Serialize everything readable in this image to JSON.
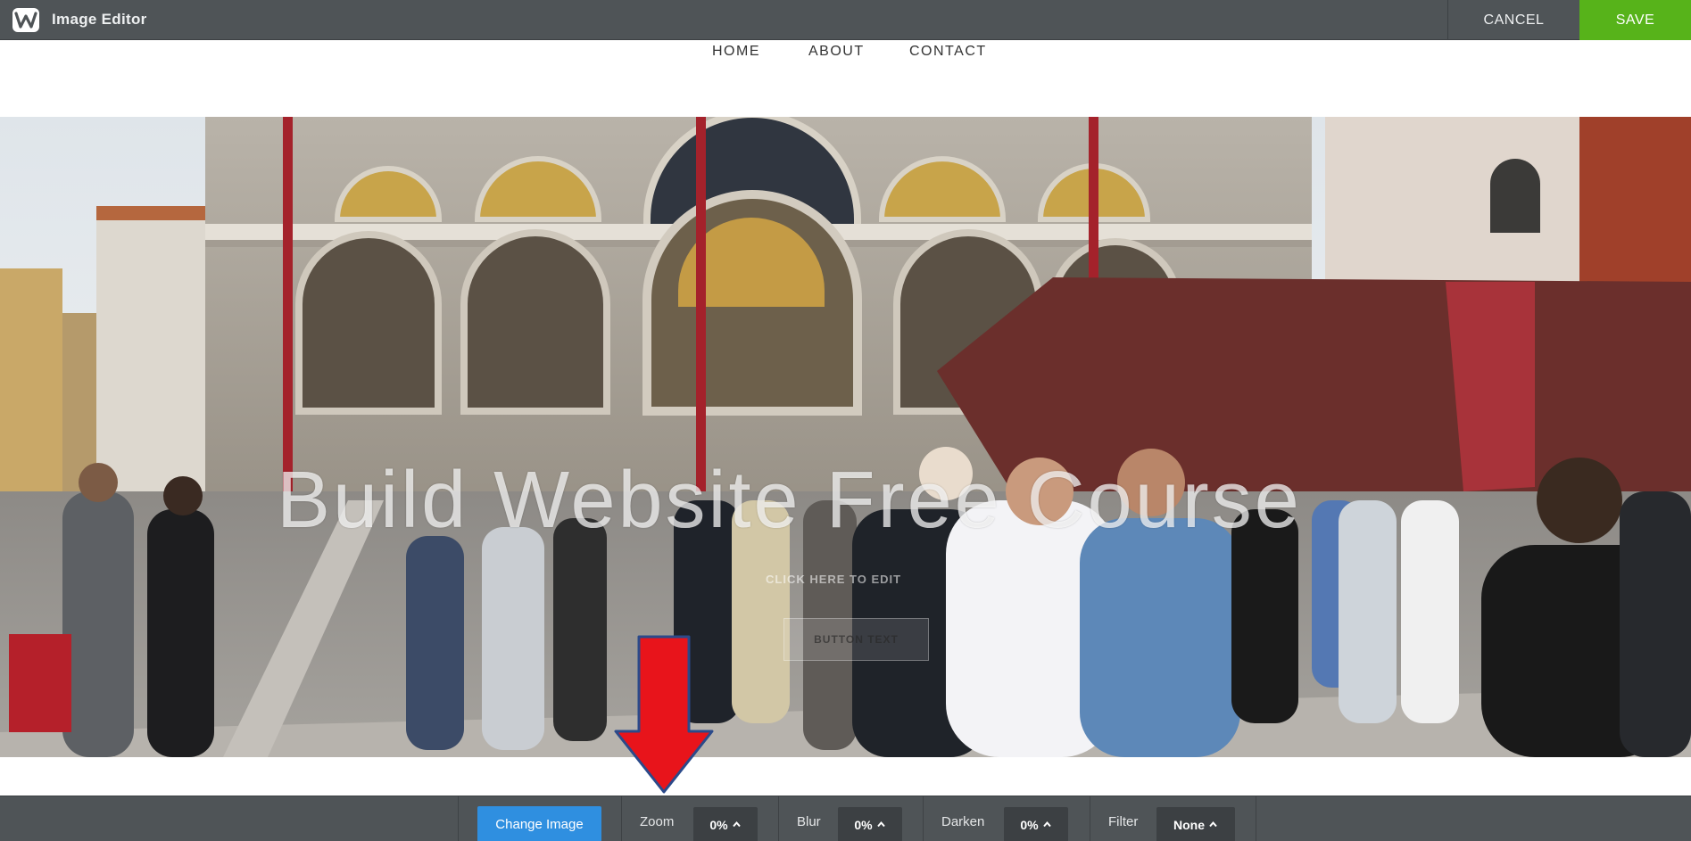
{
  "app": {
    "title": "Image Editor",
    "logo": "weebly-w-logo"
  },
  "topbar": {
    "cancel_label": "CANCEL",
    "save_label": "SAVE"
  },
  "site_nav": {
    "items": [
      "HOME",
      "ABOUT",
      "CONTACT"
    ]
  },
  "hero": {
    "heading": "Build Website Free Course",
    "cta_hint": "CLICK HERE TO EDIT",
    "button_text": "BUTTON TEXT"
  },
  "annotation": {
    "icon": "red-down-arrow-icon",
    "color": "#e8141b"
  },
  "toolbar": {
    "change_image_label": "Change Image",
    "zoom": {
      "label": "Zoom",
      "value": "0%"
    },
    "blur": {
      "label": "Blur",
      "value": "0%"
    },
    "darken": {
      "label": "Darken",
      "value": "0%"
    },
    "filter": {
      "label": "Filter",
      "value": "None"
    }
  },
  "colors": {
    "bar": "#4f5457",
    "save": "#57b31a",
    "change_image": "#2f8fe0"
  }
}
